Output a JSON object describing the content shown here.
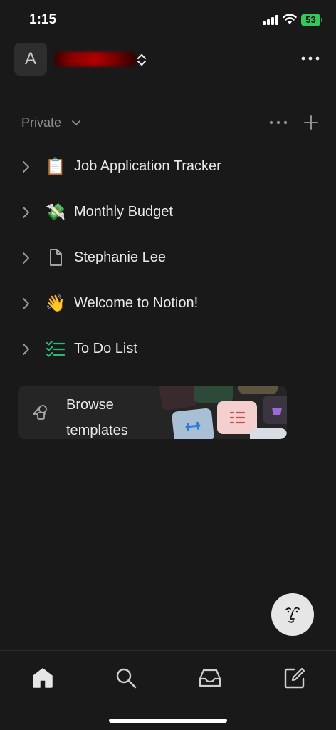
{
  "status_bar": {
    "time": "1:15",
    "battery_percent": "53",
    "battery_color": "#35c759",
    "icons": [
      "signal-icon",
      "wifi-icon",
      "battery-icon"
    ]
  },
  "workspace": {
    "avatar_letter": "A",
    "name_redacted": true
  },
  "section": {
    "label": "Private"
  },
  "pages": [
    {
      "icon": "clipboard-icon",
      "emoji": "📋",
      "title": "Job Application Tracker"
    },
    {
      "icon": "money-wings-icon",
      "emoji": "💸",
      "title": "Monthly Budget"
    },
    {
      "icon": "document-icon",
      "emoji": "",
      "title": "Stephanie Lee"
    },
    {
      "icon": "waving-hand-icon",
      "emoji": "👋",
      "title": "Welcome to Notion!"
    },
    {
      "icon": "checklist-icon",
      "emoji": "",
      "title": "To Do List"
    }
  ],
  "templates_card": {
    "label": "Browse templates"
  },
  "bottom_nav": {
    "items": [
      "home-icon",
      "search-icon",
      "inbox-icon",
      "compose-icon"
    ]
  }
}
